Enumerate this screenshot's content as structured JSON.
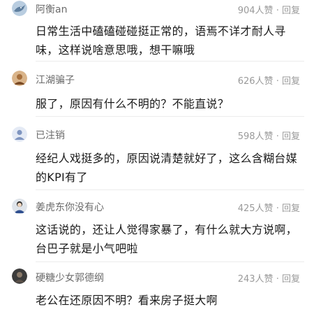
{
  "comments": [
    {
      "username": "阿衡an",
      "likes": "904人赞",
      "dot": "·",
      "reply_label": "回复",
      "text": "日常生活中磕磕碰碰挺正常的，语焉不详才耐人寻味，这样说啥意思哦，想干嘛哦",
      "avatar_icon": "avatar-shark-icon"
    },
    {
      "username": "江湖骗子",
      "likes": "626人赞",
      "dot": "·",
      "reply_label": "回复",
      "text": "服了，原因有什么不明的？不能直说？",
      "avatar_icon": "avatar-photo-icon"
    },
    {
      "username": "已注销",
      "likes": "598人赞",
      "dot": "·",
      "reply_label": "回复",
      "text": "经纪人戏挺多的，原因说清楚就好了，这么含糊台媒的KPI有了",
      "avatar_icon": "avatar-default-icon"
    },
    {
      "username": "姜虎东你没有心",
      "likes": "425人赞",
      "dot": "·",
      "reply_label": "回复",
      "text": "这话说的，还让人觉得家暴了，有什么就大方说啊，台巴子就是小气吧啦",
      "avatar_icon": "avatar-person-icon"
    },
    {
      "username": "硬糖少女郭德纲",
      "likes": "243人赞",
      "dot": "·",
      "reply_label": "回复",
      "text": "老公在还原因不明？看来房子挺大啊",
      "avatar_icon": "avatar-dark-icon"
    }
  ]
}
